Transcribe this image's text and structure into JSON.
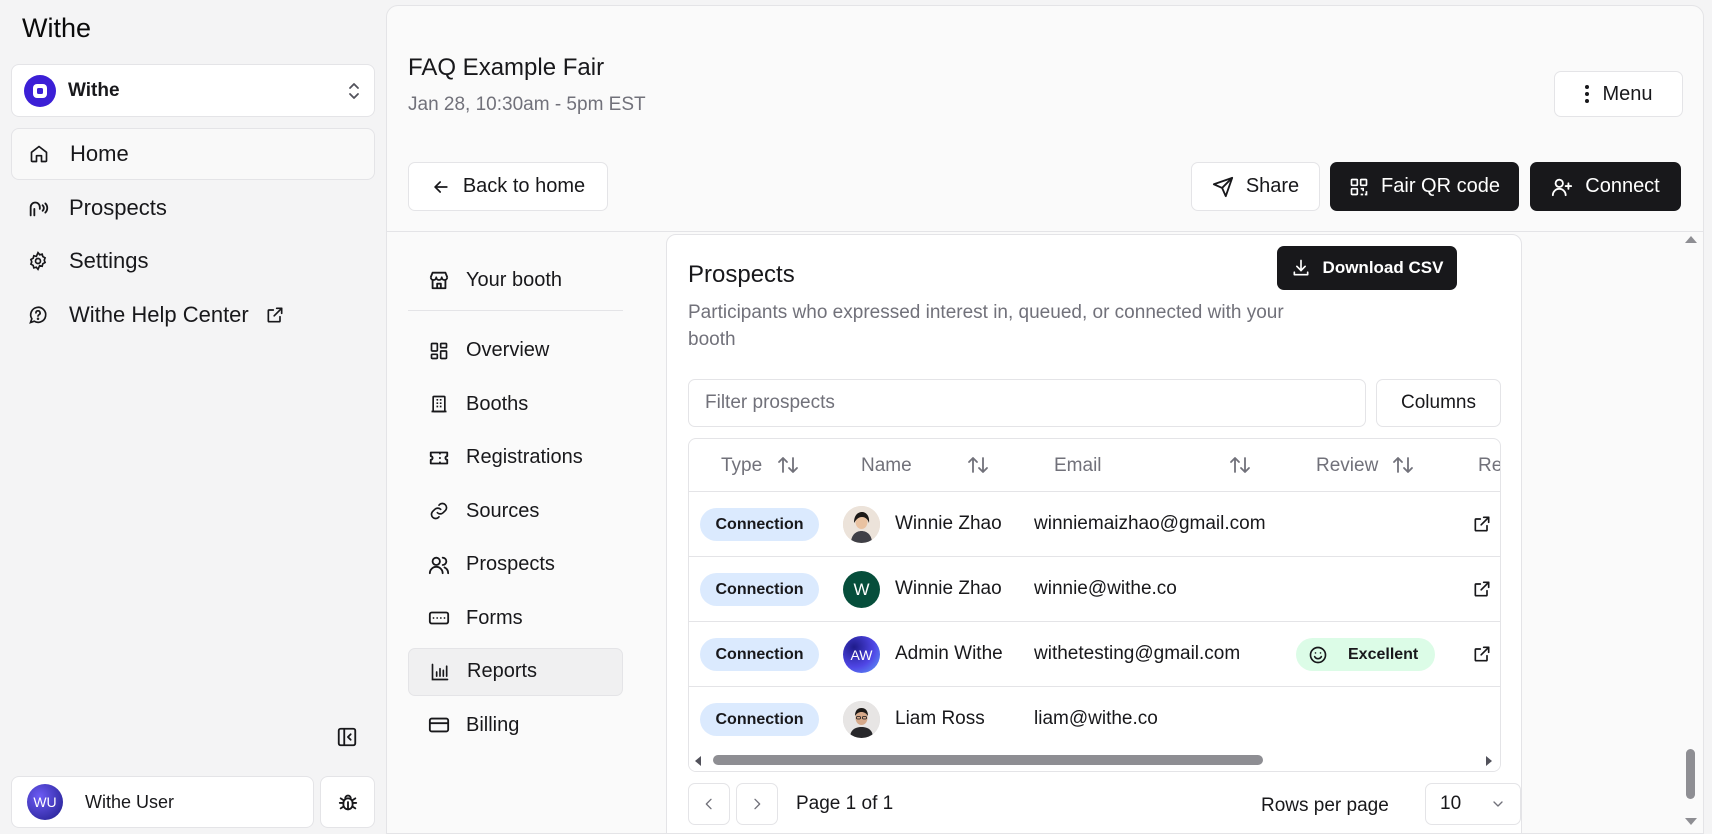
{
  "app": {
    "title": "Withe"
  },
  "org_switcher": {
    "name": "Withe",
    "logo_icon": "withe-logo-icon"
  },
  "sidebar": {
    "items": [
      {
        "label": "Home",
        "icon": "home-icon",
        "active": true
      },
      {
        "label": "Prospects",
        "icon": "prospects-icon"
      },
      {
        "label": "Settings",
        "icon": "gear-icon"
      },
      {
        "label": "Withe Help Center",
        "icon": "help-chat-icon",
        "external": true
      }
    ]
  },
  "user": {
    "initials": "WU",
    "name": "Withe User"
  },
  "event": {
    "title": "FAQ Example Fair",
    "date": "Jan 28, 10:30am - 5pm EST"
  },
  "header_buttons": {
    "menu": "Menu",
    "back": "Back to home",
    "share": "Share",
    "qr": "Fair QR code",
    "connect": "Connect"
  },
  "subnav": {
    "booth": "Your booth",
    "items": [
      {
        "label": "Overview",
        "icon": "overview-grid-icon"
      },
      {
        "label": "Booths",
        "icon": "building-icon"
      },
      {
        "label": "Registrations",
        "icon": "ticket-icon"
      },
      {
        "label": "Sources",
        "icon": "link-icon"
      },
      {
        "label": "Prospects",
        "icon": "users-icon"
      },
      {
        "label": "Forms",
        "icon": "form-icon"
      },
      {
        "label": "Reports",
        "icon": "bar-chart-icon",
        "active": true
      },
      {
        "label": "Billing",
        "icon": "credit-card-icon"
      }
    ]
  },
  "prospects": {
    "title": "Prospects",
    "description": "Participants who expressed interest in, queued, or connected with your booth",
    "download_label": "Download CSV",
    "filter_placeholder": "Filter prospects",
    "columns_label": "Columns",
    "headers": {
      "type": "Type",
      "name": "Name",
      "email": "Email",
      "review": "Review",
      "last": "Re"
    },
    "rows": [
      {
        "type": "Connection",
        "name": "Winnie Zhao",
        "email": "winniemaizhao@gmail.com",
        "review": "",
        "avatar": "photo",
        "avatar_color": "#e7d7c9"
      },
      {
        "type": "Connection",
        "name": "Winnie Zhao",
        "email": "winnie@withe.co",
        "review": "",
        "avatar_initial": "W",
        "avatar_color": "#064e3b"
      },
      {
        "type": "Connection",
        "name": "Admin Withe",
        "email": "withetesting@gmail.com",
        "review": "Excellent",
        "avatar_initial": "AW",
        "avatar_color": "#4f46e5"
      },
      {
        "type": "Connection",
        "name": "Liam Ross",
        "email": "liam@withe.co",
        "review": "",
        "avatar": "photo",
        "avatar_color": "#d6d3d1"
      }
    ],
    "pagination": {
      "page_label": "Page 1 of 1",
      "rows_per_page_label": "Rows per page",
      "rows_per_page": "10"
    }
  },
  "colors": {
    "dark": "#18181b",
    "badge_blue": "#dbeafe",
    "badge_green": "#dcfce7",
    "muted": "#71717a",
    "org_purple": "#3b1fd6"
  }
}
